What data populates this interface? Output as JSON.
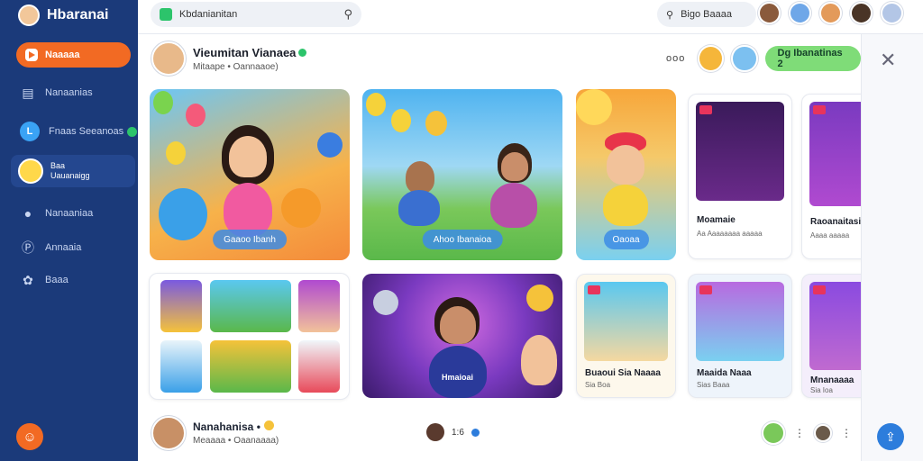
{
  "app": {
    "name": "Hbaranai"
  },
  "sidebar": {
    "primary_label": "Naaaaa",
    "items": [
      {
        "label": "Nanaanias",
        "icon": "grid-icon"
      },
      {
        "label": "Fnaas Seeanoas",
        "icon": "l-badge-icon"
      },
      {
        "label": "Nanaaniaa",
        "icon": "person-icon"
      },
      {
        "label": "Annaaia",
        "icon": "p-icon"
      },
      {
        "label": "Baaa",
        "icon": "gamepad-icon"
      }
    ],
    "active": {
      "line1": "Baa",
      "line2": "Uauanaigg"
    }
  },
  "topbar": {
    "search_value": "Kbdanianitan",
    "right_search_value": "Bigo Baaaa"
  },
  "post": {
    "author": "Vieumitan Vianaea",
    "sub": "Mitaape  •  Oannaaoe)",
    "dots": "ooo",
    "follow_label": "Dg Ibanatinas 2"
  },
  "cards": {
    "card1_pill": "Gaaoo Ibanh",
    "card2_pill": "Ahoo Ibanaioa",
    "card3_pill": "Oaoaa"
  },
  "tiles": {
    "t1_title": "Moamaie",
    "t1_sub": "Aa Aaaaaaaa aaaaa",
    "t2_title": "Raoanaitasi",
    "t2_sub": "Aaaa aaaaa",
    "t3_title": "Buaoui Sia Naaaa",
    "t3_sub": "Sia Boa",
    "t4_title": "Maaida Naaa",
    "t4_sub": "Sias Baaa",
    "t5_title": "Mnanaaaa",
    "t5_sub": "Sia Ioa",
    "card_center_text": "Hmaioai"
  },
  "post2": {
    "author": "Nanahanisa •",
    "sub": "Meaaaa  •  Oaanaaaa)",
    "mid_count": "1:6",
    "dots": "⋮"
  },
  "colors": {
    "sidebar": "#1b3a7a",
    "accent_orange": "#f26a23",
    "follow_green": "#7fdc78",
    "link_blue": "#2d7ddc"
  }
}
